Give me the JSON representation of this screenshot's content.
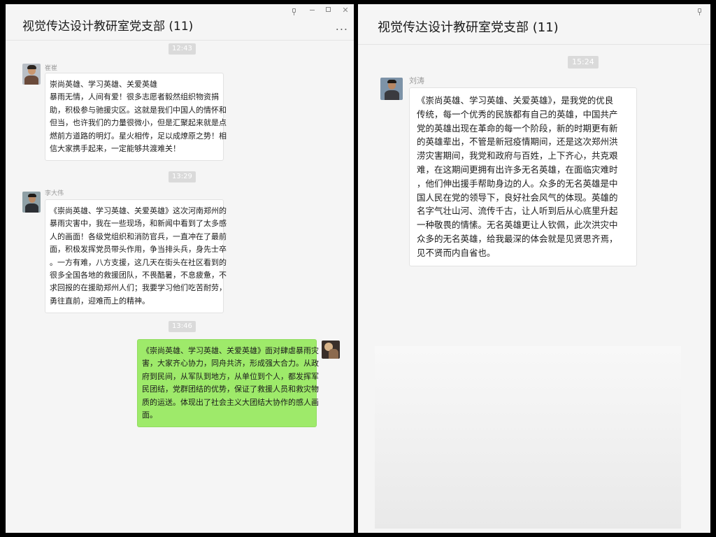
{
  "left": {
    "title": "视觉传达设计教研室党支部 (11)",
    "more_label": "...",
    "messages": [
      {
        "time": "12:43",
        "sender": "崔崔",
        "lines": [
          "崇尚英雄、学习英雄、关爱英雄",
          "   暴雨无情，人间有爱！很多志愿者毅然组织物资捐",
          "助，积极参与驰援灾区。这就是我们中国人的情怀和",
          "但当，也许我们的力量很微小，但是汇聚起来就是点",
          "燃前方道路的明灯。星火相传，足以成燎原之势！相",
          "信大家携手起来，一定能够共渡难关！"
        ]
      },
      {
        "time": "13:29",
        "sender": "李大伟",
        "lines": [
          "《崇尚英雄、学习英雄、关爱英雄》这次河南郑州的",
          "暴雨灾害中，我在一些现场，和新闻中看到了太多感",
          "人的画面！各级党组织和消防官兵，一直冲在了最前",
          "面，积极发挥党员带头作用，争当排头兵，身先士卒",
          "。一方有难，八方支援，这几天在街头在社区看到的",
          "很多全国各地的救援团队，不畏酷暑，不息疲惫，不",
          "求回报的在援助郑州人们；我要学习他们吃苦耐劳，",
          "勇往直前，迎难而上的精神。"
        ]
      },
      {
        "time": "13:46",
        "lines": [
          "《崇尚英雄、学习英雄、关爱英雄》面对肆虐暴雨灾",
          "害，大家齐心协力，同舟共济，形成强大合力。从政",
          "府到民间，从军队到地方，从单位到个人，都发挥军",
          "民团结，党群团结的优势，保证了救援人员和救灾物",
          "质的运送。体现出了社会主义大团结大协作的感人画",
          "面。"
        ]
      }
    ]
  },
  "right": {
    "title": "视觉传达设计教研室党支部 (11)",
    "message": {
      "time": "15:24",
      "sender": "刘涛",
      "lines": [
        "《崇尚英雄、学习英雄、关爱英雄》，是我党的优良",
        "传统，每一个优秀的民族都有自己的英雄，中国共产",
        "党的英雄出现在革命的每一个阶段，新的时期更有新",
        "的英雄辈出，不管是新冠疫情期间，还是这次郑州洪",
        "涝灾害期间，我党和政府与百姓，上下齐心，共克艰",
        "难，在这期间更拥有出许多无名英雄，在面临灾难时",
        "，他们伸出援手帮助身边的人。众多的无名英雄是中",
        "国人民在党的领导下，良好社会风气的体现。英雄的",
        "名字气壮山河、流传千古，让人听到后从心底里升起",
        "一种敬畏的情愫。无名英雄更让人钦佩，此次洪灾中",
        "众多的无名英雄，给我最深的体会就是见贤思齐焉，",
        "见不贤而内自省也。"
      ]
    }
  }
}
